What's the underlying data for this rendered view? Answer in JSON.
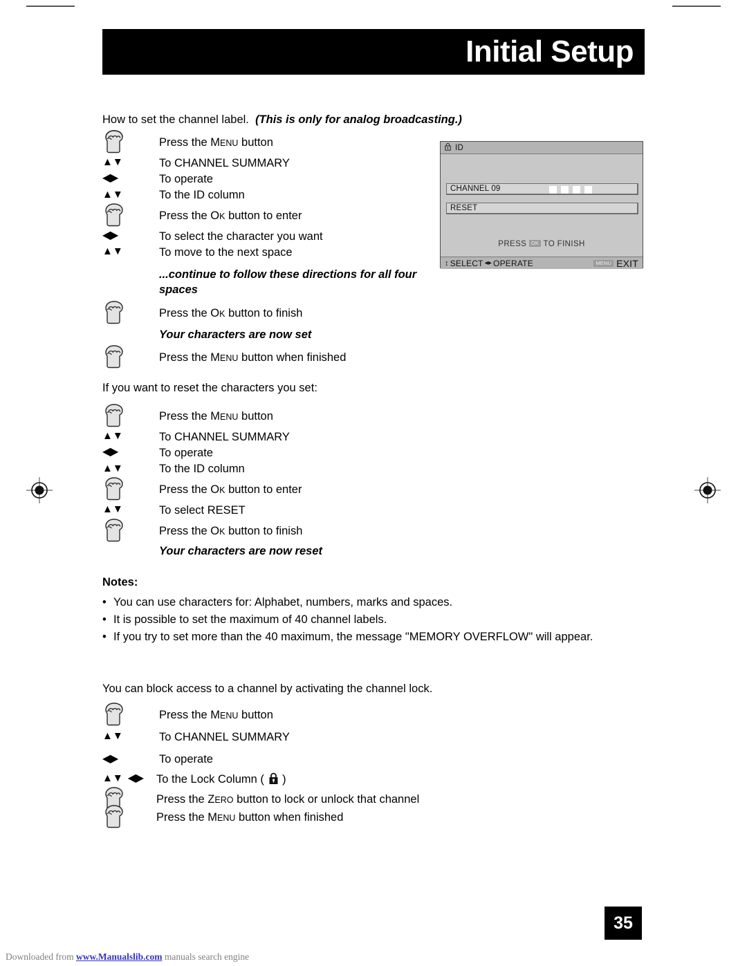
{
  "header": {
    "title": "Initial Setup"
  },
  "intro": {
    "plain": "How to set the channel label.",
    "emphasis": "(This is only for analog broadcasting.)"
  },
  "section_label_steps": [
    {
      "key": "hand-icon",
      "text_prefix": "Press the ",
      "keycap": "MENU",
      "text_suffix": " button"
    },
    {
      "key": "updown-arrows",
      "text": "To CHANNEL SUMMARY"
    },
    {
      "key": "leftright-arrows",
      "text": "To operate"
    },
    {
      "key": "updown-arrows",
      "text": "To the ID column"
    },
    {
      "key": "hand-icon",
      "text_prefix": "Press the ",
      "keycap": "OK",
      "text_suffix": " button to enter"
    },
    {
      "key": "leftright-arrows",
      "text": "To select the character you want"
    },
    {
      "key": "updown-arrows",
      "text": "To move to the next space"
    }
  ],
  "continue_note": "...continue to follow these directions for all four spaces",
  "finish_steps": [
    {
      "key": "hand-icon",
      "text_prefix": "Press the ",
      "keycap": "OK",
      "text_suffix": " button to finish"
    },
    {
      "key": "none",
      "text": "Your characters are now set",
      "style": "italic-bold"
    },
    {
      "key": "hand-icon",
      "text_prefix": "Press the ",
      "keycap": "MENU",
      "text_suffix": " button when finished"
    }
  ],
  "reset_intro": "If you want to reset the characters you set:",
  "reset_steps": [
    {
      "key": "hand-icon",
      "text_prefix": "Press the ",
      "keycap": "MENU",
      "text_suffix": " button"
    },
    {
      "key": "updown-arrows",
      "text": "To CHANNEL SUMMARY"
    },
    {
      "key": "leftright-arrows",
      "text": "To operate"
    },
    {
      "key": "updown-arrows",
      "text": "To the ID column"
    },
    {
      "key": "hand-icon",
      "text_prefix": "Press the ",
      "keycap": "OK",
      "text_suffix": " button to enter"
    },
    {
      "key": "updown-arrows",
      "text": "To select RESET"
    },
    {
      "key": "hand-icon",
      "text_prefix": "Press the ",
      "keycap": "OK",
      "text_suffix": " button to finish"
    },
    {
      "key": "none",
      "text": "Your characters are now reset",
      "style": "italic-bold"
    }
  ],
  "notes": {
    "title": "Notes:",
    "bullet": "•",
    "items": [
      "You can use characters for: Alphabet, numbers, marks and spaces.",
      "It is possible to set the maximum of 40 channel labels.",
      "If you try to set more than the 40 maximum, the message \"MEMORY OVERFLOW\" will appear."
    ]
  },
  "lock_intro": "You can block access to a channel by activating the channel lock.",
  "lock_steps": [
    {
      "key": "hand-icon",
      "text_prefix": "Press the ",
      "keycap": "MENU",
      "text_suffix": " button"
    },
    {
      "key": "updown-arrows",
      "text": "To CHANNEL SUMMARY"
    },
    {
      "key": "leftright-arrows",
      "text": "To operate"
    },
    {
      "key": "both-arrows",
      "text_prefix": "To the Lock Column ( ",
      "icon": "lock-icon",
      "text_suffix": " )"
    },
    {
      "key": "hand-icon",
      "text_prefix": "Press the ",
      "keycap": "ZERO",
      "text_suffix": " button to lock or unlock that channel"
    },
    {
      "key": "hand-icon",
      "text_prefix": "Press the ",
      "keycap": "MENU",
      "text_suffix": " button when finished"
    }
  ],
  "osd": {
    "title": "ID",
    "title_icon": "lock-icon",
    "rows": [
      {
        "label": "CHANNEL 09",
        "char_boxes": 4
      },
      {
        "label": "RESET",
        "char_boxes": 0
      }
    ],
    "finish_prefix": "PRESS ",
    "finish_chip": "OK",
    "finish_suffix": " TO FINISH",
    "footer_select": "SELECT",
    "footer_operate": "OPERATE",
    "footer_exit_chip": "MENU",
    "footer_exit": "EXIT"
  },
  "page_number": "35",
  "download_footer": {
    "prefix": "Downloaded from ",
    "link": "www.Manualslib.com",
    "suffix": " manuals search engine"
  },
  "colors": {
    "header_bg": "#000000",
    "osd_bg": "#c8c8c8",
    "osd_bar": "#b4b4b4",
    "link": "#3333cc"
  }
}
